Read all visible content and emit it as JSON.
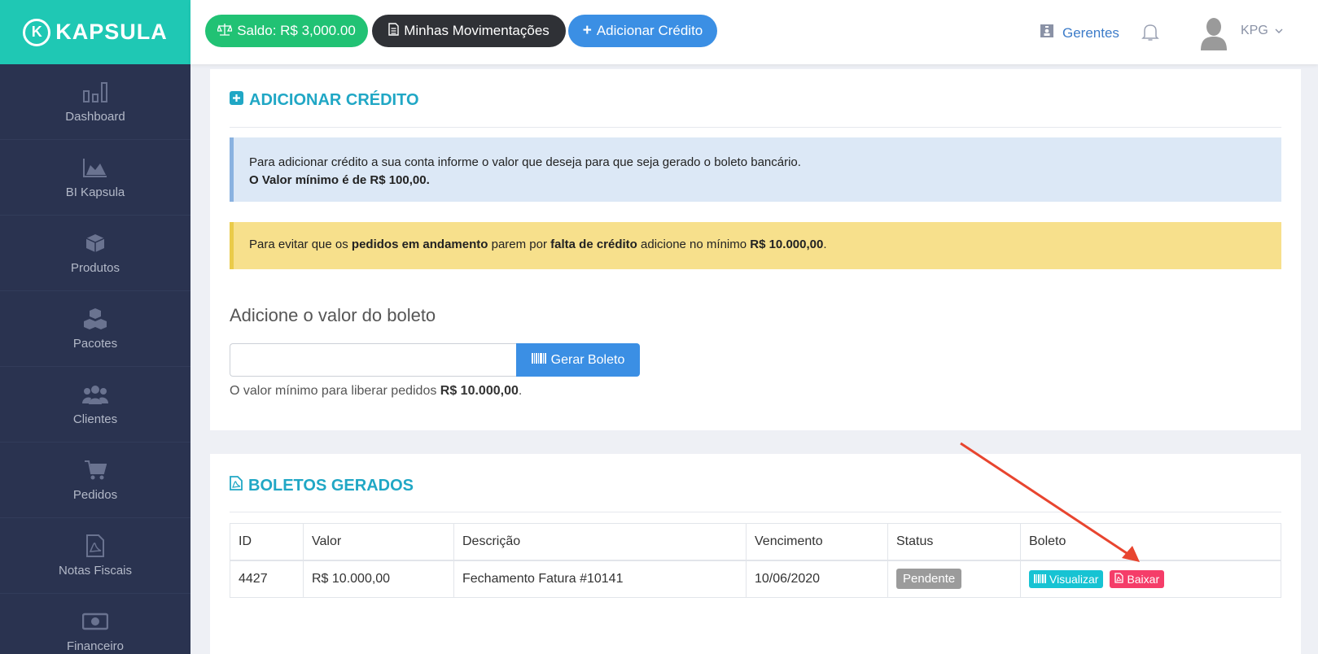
{
  "brand": {
    "name": "KAPSULA",
    "mark": "K"
  },
  "sidebar": {
    "items": [
      {
        "label": "Dashboard",
        "icon": "bar-chart-icon"
      },
      {
        "label": "BI Kapsula",
        "icon": "area-chart-icon"
      },
      {
        "label": "Produtos",
        "icon": "cube-icon"
      },
      {
        "label": "Pacotes",
        "icon": "cubes-icon"
      },
      {
        "label": "Clientes",
        "icon": "users-icon"
      },
      {
        "label": "Pedidos",
        "icon": "cart-icon"
      },
      {
        "label": "Notas Fiscais",
        "icon": "pdf-file-icon"
      },
      {
        "label": "Financeiro",
        "icon": "money-icon"
      }
    ]
  },
  "topbar": {
    "saldo_label": "Saldo: R$ 3,000.00",
    "movimentacoes_label": "Minhas Movimentações",
    "add_credit_label": "Adicionar Crédito",
    "gerentes_label": "Gerentes",
    "user_label": "KPG"
  },
  "add_credit": {
    "title": "ADICIONAR CRÉDITO",
    "info_line1": "Para adicionar crédito a sua conta informe o valor que deseja para que seja gerado o boleto bancário.",
    "info_line2": "O Valor mínimo é de R$ 100,00.",
    "warn_1": "Para evitar que os ",
    "warn_2": "pedidos em andamento",
    "warn_3": " parem por ",
    "warn_4": "falta de crédito",
    "warn_5": " adicione no mínimo ",
    "warn_6": "R$ 10.000,00",
    "warn_7": ".",
    "form_label": "Adicione o valor do boleto",
    "input_value": "",
    "button_label": "Gerar Boleto",
    "hint_1": "O valor mínimo para liberar pedidos ",
    "hint_2": "R$ 10.000,00",
    "hint_3": "."
  },
  "boletos": {
    "title": "BOLETOS GERADOS",
    "columns": [
      "ID",
      "Valor",
      "Descrição",
      "Vencimento",
      "Status",
      "Boleto"
    ],
    "rows": [
      {
        "id": "4427",
        "valor": "R$ 10.000,00",
        "descricao": "Fechamento Fatura #10141",
        "vencimento": "10/06/2020",
        "status": "Pendente",
        "visualizar": "Visualizar",
        "baixar": "Baixar"
      }
    ]
  },
  "colors": {
    "brand": "#1fc8b4",
    "sidebar": "#2a3350",
    "accent": "#20a7c5",
    "primary": "#3b8fe4",
    "success": "#21c274",
    "danger": "#f53d69",
    "annotation_arrow": "#e8452f"
  }
}
